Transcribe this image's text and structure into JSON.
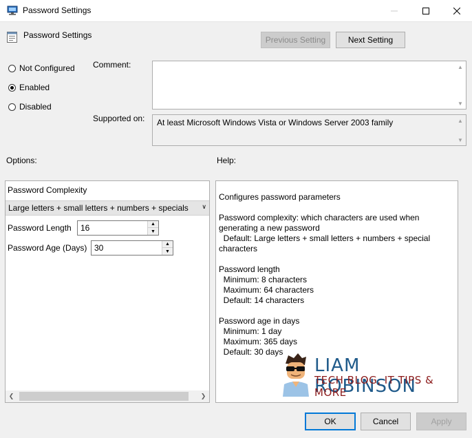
{
  "window": {
    "title": "Password Settings",
    "minimize_icon": "minimize-icon",
    "maximize_icon": "maximize-icon",
    "close_icon": "close-icon"
  },
  "header": {
    "policy_title": "Password Settings",
    "previous_button": "Previous Setting",
    "next_button": "Next Setting"
  },
  "state": {
    "options": [
      {
        "label": "Not Configured",
        "checked": false
      },
      {
        "label": "Enabled",
        "checked": true
      },
      {
        "label": "Disabled",
        "checked": false
      }
    ]
  },
  "comment": {
    "label": "Comment:",
    "value": ""
  },
  "supported": {
    "label": "Supported on:",
    "value": "At least Microsoft Windows Vista or Windows Server 2003 family"
  },
  "options_label": "Options:",
  "help_label": "Help:",
  "options": {
    "complexity_label": "Password Complexity",
    "complexity_value": "Large letters + small letters + numbers + specials",
    "length_label": "Password Length",
    "length_value": "16",
    "age_label": "Password Age (Days)",
    "age_value": "30"
  },
  "help": {
    "lines": [
      "Configures password parameters",
      "",
      "Password complexity: which characters are used when",
      "generating a new password",
      "  Default: Large letters + small letters + numbers + special",
      "characters",
      "",
      "Password length",
      "  Minimum: 8 characters",
      "  Maximum: 64 characters",
      "  Default: 14 characters",
      "",
      "Password age in days",
      "  Minimum: 1 day",
      "  Maximum: 365 days",
      "  Default: 30 days"
    ]
  },
  "watermark": {
    "name": "LIAM ROBINSON",
    "tagline": "TECH BLOG, IT TIPS & MORE"
  },
  "footer": {
    "ok": "OK",
    "cancel": "Cancel",
    "apply": "Apply"
  },
  "colors": {
    "accent": "#0078d7",
    "logo_blue": "#1f5a8a",
    "logo_red": "#8b1a1a"
  }
}
